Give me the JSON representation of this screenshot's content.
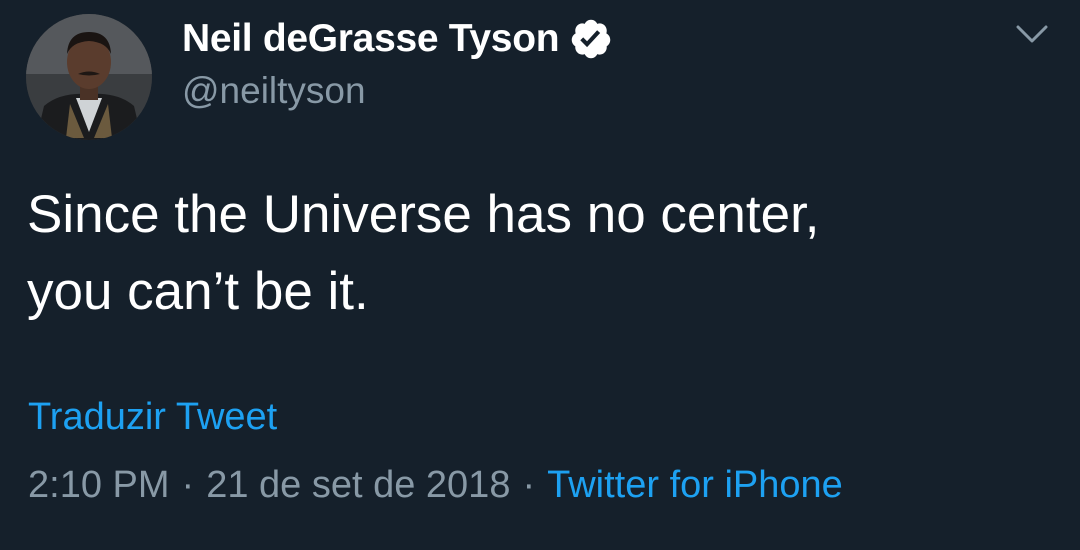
{
  "tweet": {
    "display_name": "Neil deGrasse Tyson",
    "handle": "@neiltyson",
    "text_lines": [
      "Since the Universe has no center,",
      "you can’t be it."
    ],
    "translate_label": "Traduzir Tweet",
    "time": "2:10 PM",
    "date": "21 de set de 2018",
    "separator": "·",
    "source": "Twitter for iPhone"
  },
  "icons": {
    "verified": "verified-badge-icon",
    "menu": "chevron-down-icon"
  },
  "colors": {
    "background": "#15202b",
    "primary_text": "#ffffff",
    "secondary_text": "#8899a6",
    "accent": "#1da1f2"
  }
}
